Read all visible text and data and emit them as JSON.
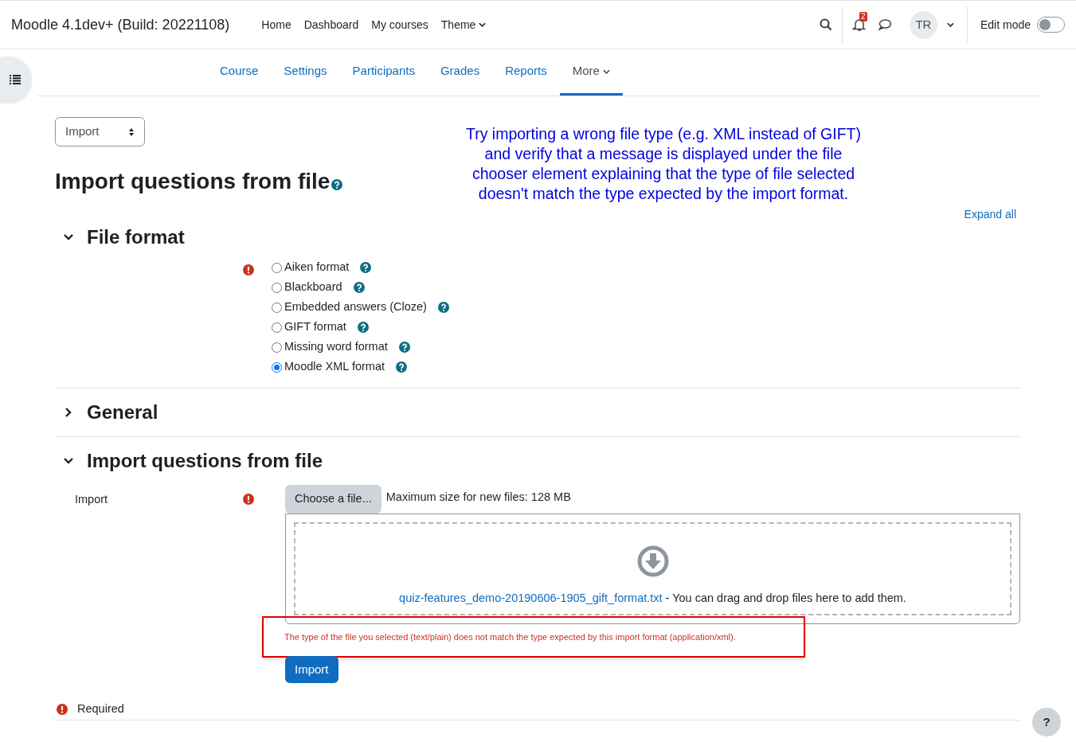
{
  "navbar": {
    "brand": "Moodle 4.1dev+ (Build: 20221108)",
    "links": [
      {
        "label": "Home",
        "dropdown": false
      },
      {
        "label": "Dashboard",
        "dropdown": false
      },
      {
        "label": "My courses",
        "dropdown": false
      },
      {
        "label": "Theme",
        "dropdown": true
      }
    ],
    "notification_count": "2",
    "avatar": "TR",
    "edit_mode": {
      "label": "Edit mode",
      "on": false
    }
  },
  "secondary_nav": [
    {
      "label": "Course",
      "selected": false,
      "dropdown": false
    },
    {
      "label": "Settings",
      "selected": false,
      "dropdown": false
    },
    {
      "label": "Participants",
      "selected": false,
      "dropdown": false
    },
    {
      "label": "Grades",
      "selected": false,
      "dropdown": false
    },
    {
      "label": "Reports",
      "selected": false,
      "dropdown": false
    },
    {
      "label": "More",
      "selected": true,
      "dropdown": true
    }
  ],
  "action_select": {
    "value": "Import"
  },
  "heading": "Import questions from file",
  "annotation": "Try importing a wrong file type (e.g. XML instead of GIFT) and verify that a message is displayed under the file chooser element explaining that the type of file selected doesn't match the type expected by the import format.",
  "expand_all": "Expand all",
  "sections": [
    {
      "kind": "formats",
      "title": "File format",
      "expanded": true,
      "required": true,
      "options": [
        {
          "label": "Aiken format",
          "selected": false
        },
        {
          "label": "Blackboard",
          "selected": false
        },
        {
          "label": "Embedded answers (Cloze)",
          "selected": false
        },
        {
          "label": "GIFT format",
          "selected": false
        },
        {
          "label": "Missing word format",
          "selected": false
        },
        {
          "label": "Moodle XML format",
          "selected": true
        }
      ]
    },
    {
      "title": "General",
      "expanded": false
    },
    {
      "kind": "file",
      "title": "Import questions from file",
      "expanded": true,
      "field_label": "Import",
      "required": true,
      "choose_button": "Choose a file...",
      "max_size": "Maximum size for new files: 128 MB",
      "file_name": "quiz-features_demo-20190606-1905_gift_format.txt",
      "drop_hint": " - You can drag and drop files here to add them.",
      "error": "The type of the file you selected (text/plain) does not match the type expected by this import format (application/xml).",
      "submit": "Import"
    }
  ],
  "required_note": "Required",
  "help_button": "?"
}
